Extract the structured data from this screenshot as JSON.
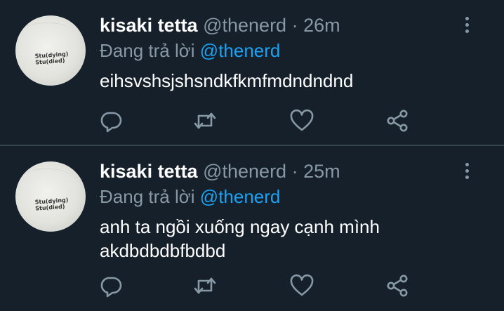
{
  "tweets": [
    {
      "name": "kisaki tetta",
      "handle": "@thenerd",
      "separator": "·",
      "time": "26m",
      "reply_prefix": "Đang trả lời",
      "reply_to": "@thenerd",
      "text": "eihsvshsjshsndkfkmfmdndndnd",
      "avatar_shirt_text": "Stu(dying)\nStu(died)"
    },
    {
      "name": "kisaki tetta",
      "handle": "@thenerd",
      "separator": "·",
      "time": "25m",
      "reply_prefix": "Đang trả lời",
      "reply_to": "@thenerd",
      "text": "anh ta ngồi xuống ngay cạnh mình\nakdbdbdbfbdbd",
      "avatar_shirt_text": "Stu(dying)\nStu(died)"
    }
  ],
  "colors": {
    "background": "#15202b",
    "divider": "#38444d",
    "secondary_text": "#8899a6",
    "accent": "#1da1f2",
    "primary_text": "#ffffff"
  },
  "icons": {
    "reply": "reply-icon",
    "retweet": "retweet-icon",
    "like": "heart-icon",
    "share": "share-icon",
    "more": "more-vertical-icon"
  }
}
